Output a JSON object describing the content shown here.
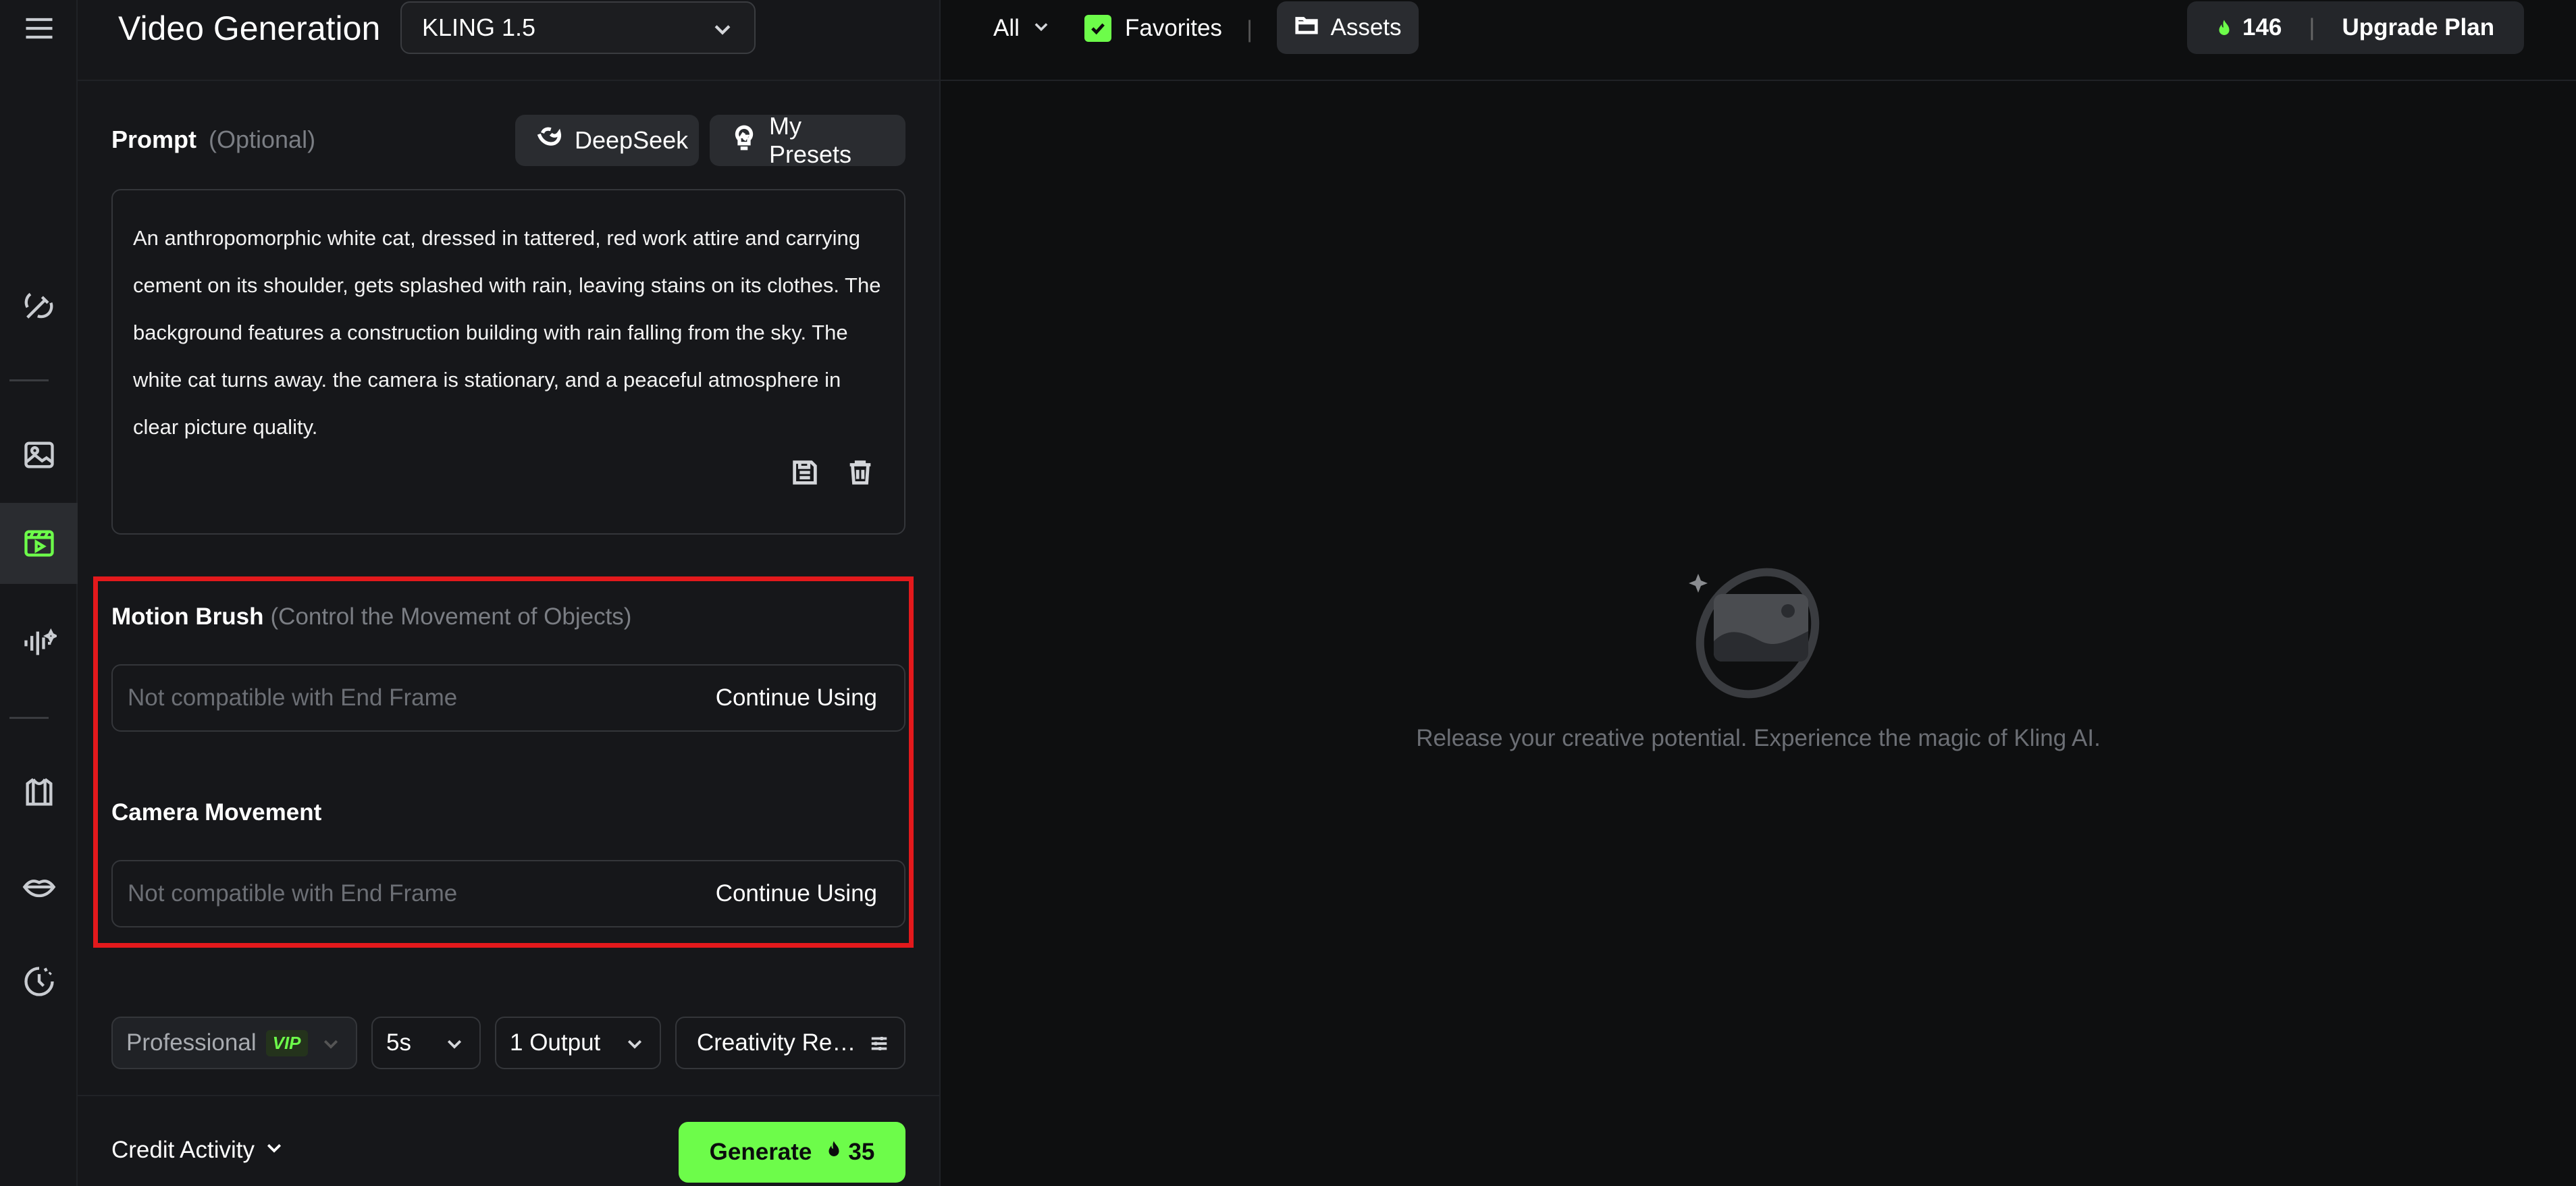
{
  "header": {
    "title": "Video Generation",
    "model": "KLING 1.5"
  },
  "prompt": {
    "label": "Prompt",
    "optional": "(Optional)",
    "deepseek_label": "DeepSeek",
    "presets_label": "My Presets",
    "text": "An anthropomorphic white cat, dressed in tattered, red work attire and carrying cement on its shoulder, gets splashed with rain, leaving stains on its clothes. The background features a construction building with rain falling from the sky. The white cat turns away. the camera is stationary, and a peaceful atmosphere in clear picture quality."
  },
  "motion_brush": {
    "label": "Motion Brush",
    "hint": "(Control the Movement of Objects)",
    "placeholder": "Not compatible with End Frame",
    "action": "Continue Using"
  },
  "camera_movement": {
    "label": "Camera Movement",
    "placeholder": "Not compatible with End Frame",
    "action": "Continue Using"
  },
  "options": {
    "mode": "Professional",
    "vip": "VIP",
    "duration": "5s",
    "outputs": "1 Output",
    "creativity": "Creativity Re…"
  },
  "footer": {
    "credit_activity": "Credit Activity",
    "generate": "Generate",
    "cost": "35"
  },
  "main": {
    "filter": "All",
    "favorites": "Favorites",
    "divider": "|",
    "assets": "Assets",
    "credits": "146",
    "upgrade": "Upgrade Plan",
    "empty_message": "Release your creative potential. Experience the magic of Kling AI."
  },
  "colors": {
    "accent": "#6dfc4a",
    "highlight": "#e3191c",
    "panel": "#16171a",
    "bg": "#0e0f10"
  },
  "icons": [
    "menu-icon",
    "magic-edit-icon",
    "image-icon",
    "video-icon",
    "audio-icon",
    "shirt-icon",
    "lips-icon",
    "history-icon",
    "deepseek-icon",
    "presets-icon",
    "save-icon",
    "trash-icon",
    "chevron-down-icon",
    "check-icon",
    "folder-icon",
    "flame-icon",
    "sliders-icon"
  ]
}
